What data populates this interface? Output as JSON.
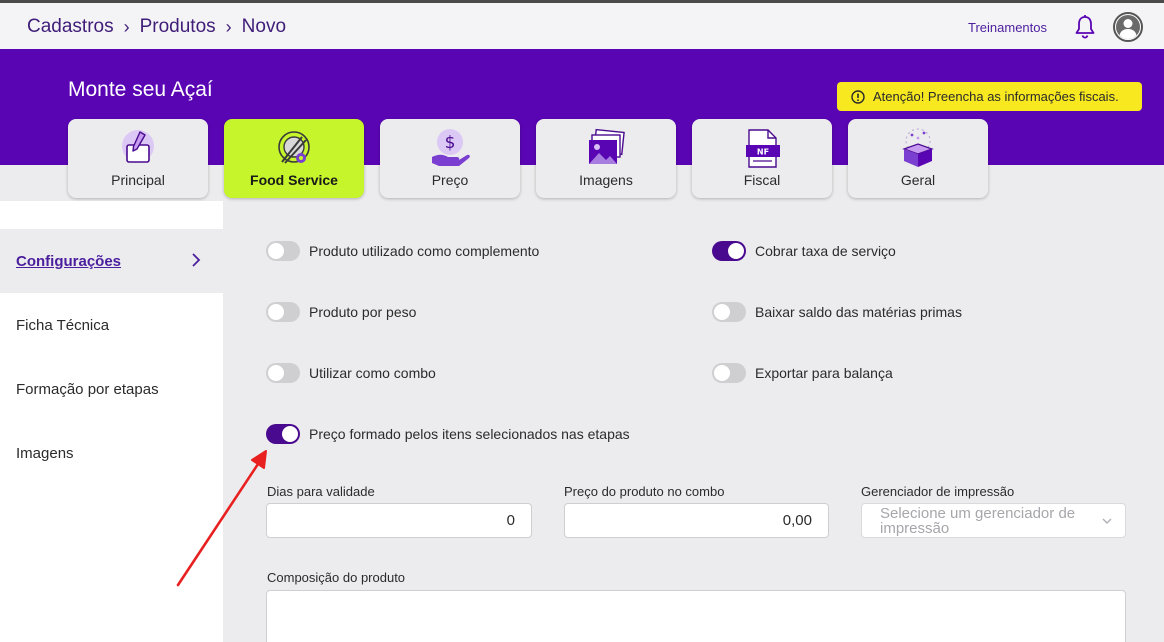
{
  "breadcrumb": [
    "Cadastros",
    "Produtos",
    "Novo"
  ],
  "header": {
    "trainings": "Treinamentos"
  },
  "page_title": "Monte seu Açaí",
  "warning": "Atenção! Preencha as informações fiscais.",
  "tabs": [
    {
      "label": "Principal",
      "icon": "pencil-checkbox-icon",
      "active": false
    },
    {
      "label": "Food Service",
      "icon": "plate-cutlery-icon",
      "active": true
    },
    {
      "label": "Preço",
      "icon": "hand-dollar-icon",
      "active": false
    },
    {
      "label": "Imagens",
      "icon": "images-icon",
      "active": false
    },
    {
      "label": "Fiscal",
      "icon": "nf-document-icon",
      "active": false
    },
    {
      "label": "Geral",
      "icon": "gift-box-icon",
      "active": false
    }
  ],
  "sidebar": {
    "items": [
      {
        "label": "Configurações",
        "active": true
      },
      {
        "label": "Ficha Técnica",
        "active": false
      },
      {
        "label": "Formação por etapas",
        "active": false
      },
      {
        "label": "Imagens",
        "active": false
      }
    ]
  },
  "toggles": [
    {
      "label": "Produto utilizado como complemento",
      "on": false
    },
    {
      "label": "Cobrar taxa de serviço",
      "on": true
    },
    {
      "label": "Produto por peso",
      "on": false
    },
    {
      "label": "Baixar saldo das matérias primas",
      "on": false
    },
    {
      "label": "Utilizar como combo",
      "on": false
    },
    {
      "label": "Exportar para balança",
      "on": false
    },
    {
      "label": "Preço formado pelos itens selecionados nas etapas",
      "on": true
    }
  ],
  "fields": {
    "validity": {
      "label": "Dias para validade",
      "value": "0"
    },
    "combo_price": {
      "label": "Preço do produto no combo",
      "value": "0,00"
    },
    "print_manager": {
      "label": "Gerenciador de impressão",
      "placeholder": "Selecione um gerenciador de impressão"
    },
    "composition": {
      "label": "Composição do produto",
      "value": ""
    }
  },
  "colors": {
    "brand": "#5a05b4",
    "active_tab": "#c5f52a",
    "toggle_on": "#4a0a8f",
    "warning": "#f7e820",
    "annotation_arrow": "#e8201f"
  }
}
